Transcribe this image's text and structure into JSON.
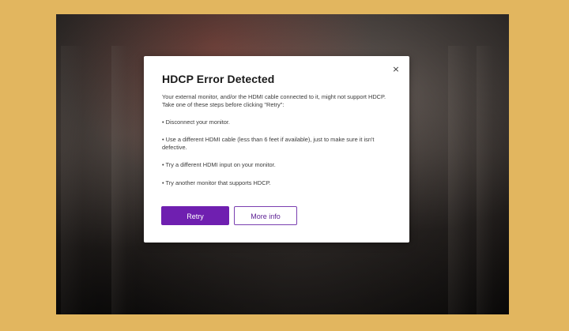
{
  "dialog": {
    "title": "HDCP Error Detected",
    "close_glyph": "×",
    "message": "Your external monitor, and/or the HDMI cable connected to it, might not support HDCP. Take one of these steps before clicking \"Retry\":",
    "steps": [
      "• Disconnect your monitor.",
      "• Use a different HDMI cable (less than 6 feet if available), just to make sure it isn't defective.",
      "• Try a different HDMI input on your monitor.",
      "• Try another monitor that supports HDCP."
    ],
    "retry_label": "Retry",
    "more_info_label": "More info"
  },
  "colors": {
    "page_background": "#e2b65f",
    "accent_purple": "#6f1fb0",
    "dialog_background": "#ffffff"
  },
  "icons": {
    "close": "close-icon"
  }
}
